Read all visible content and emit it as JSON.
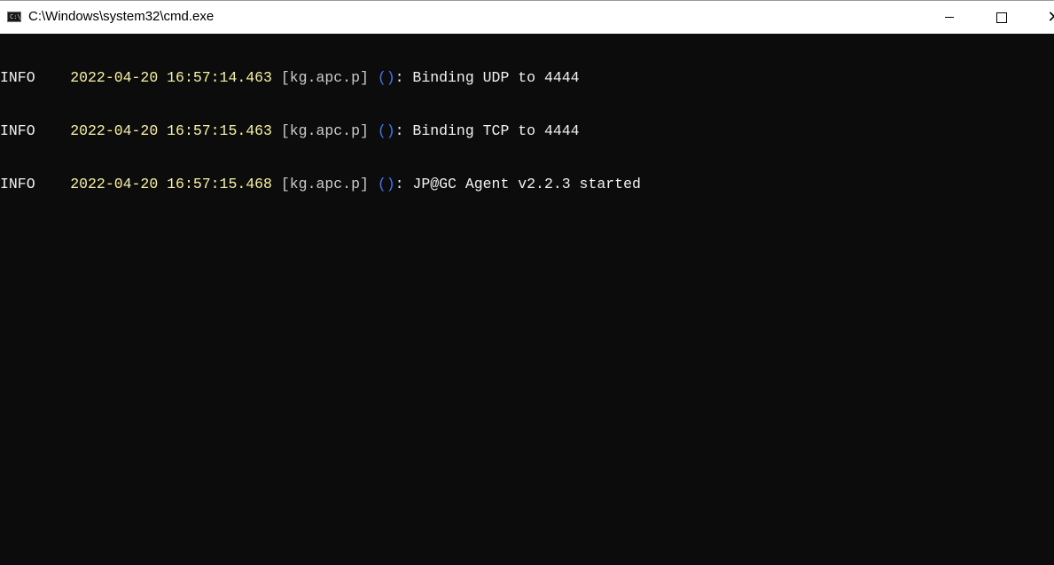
{
  "window": {
    "title": "C:\\Windows\\system32\\cmd.exe",
    "icon": "cmd-icon",
    "icon_text": "C:\\.",
    "buttons": {
      "minimize": "minimize-icon",
      "maximize": "maximize-icon",
      "close": "close-icon"
    }
  },
  "colors": {
    "level": "#f2f2f2",
    "timestamp": "#f9f1a5",
    "logger": "#cccccc",
    "parens": "#3b78ff",
    "message": "#f2f2f2",
    "background": "#0c0c0c"
  },
  "console": {
    "lines": [
      {
        "level": "INFO",
        "timestamp": "2022-04-20 16:57:14.463",
        "logger": "[kg.apc.p]",
        "parens": "()",
        "message": ": Binding UDP to 4444"
      },
      {
        "level": "INFO",
        "timestamp": "2022-04-20 16:57:15.463",
        "logger": "[kg.apc.p]",
        "parens": "()",
        "message": ": Binding TCP to 4444"
      },
      {
        "level": "INFO",
        "timestamp": "2022-04-20 16:57:15.468",
        "logger": "[kg.apc.p]",
        "parens": "()",
        "message": ": JP@GC Agent v2.2.3 started"
      }
    ]
  }
}
